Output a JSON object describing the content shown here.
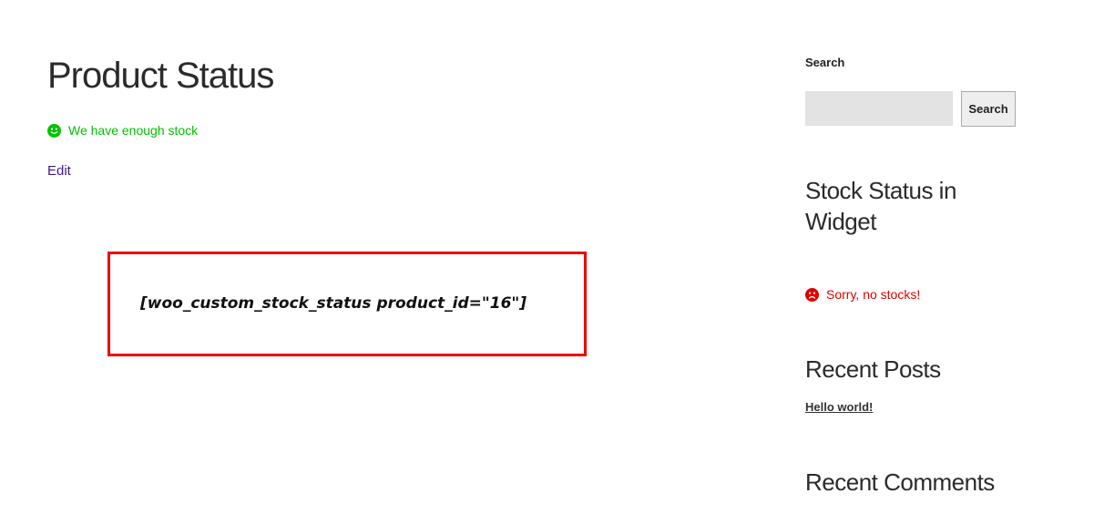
{
  "main": {
    "title": "Product Status",
    "status": {
      "text": "We have enough stock",
      "icon": "smile-icon",
      "color": "#00c200"
    },
    "edit_label": "Edit",
    "shortcode": "[woo_custom_stock_status product_id=\"16\"]",
    "highlight_color": "#f00000"
  },
  "sidebar": {
    "search": {
      "heading": "Search",
      "input_value": "",
      "button_label": "Search"
    },
    "stock_widget": {
      "heading": "Stock Status in Widget",
      "status_text": "Sorry, no stocks!",
      "icon": "frown-icon",
      "color": "#e00000"
    },
    "recent_posts": {
      "heading": "Recent Posts",
      "items": [
        "Hello world!"
      ]
    },
    "recent_comments": {
      "heading": "Recent Comments"
    }
  }
}
